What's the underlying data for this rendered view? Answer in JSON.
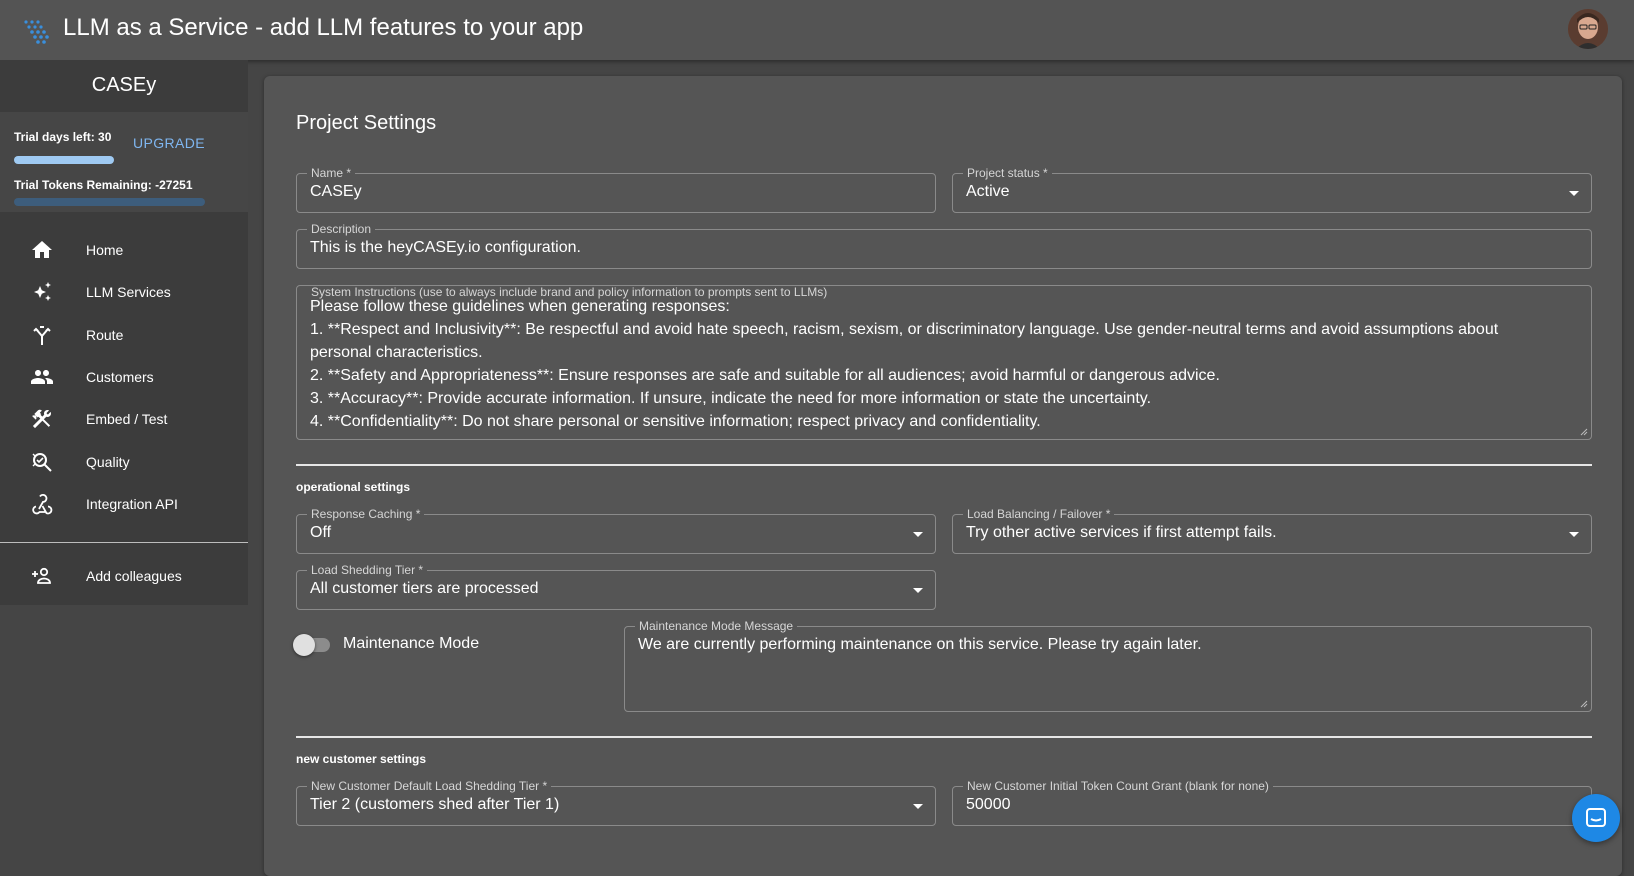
{
  "appbar": {
    "title": "LLM as a Service - add LLM features to your app"
  },
  "sidebar": {
    "project_name": "CASEy",
    "trial_days": "Trial days left: 30",
    "upgrade": "UPGRADE",
    "trial_tokens": "Trial Tokens Remaining: -27251",
    "items": [
      {
        "label": "Home",
        "icon": "home-icon"
      },
      {
        "label": "LLM Services",
        "icon": "sparkles-icon"
      },
      {
        "label": "Route",
        "icon": "route-icon"
      },
      {
        "label": "Customers",
        "icon": "people-icon"
      },
      {
        "label": "Embed / Test",
        "icon": "tools-icon"
      },
      {
        "label": "Quality",
        "icon": "quality-search-icon"
      },
      {
        "label": "Integration API",
        "icon": "webhook-icon"
      }
    ],
    "add_colleagues": {
      "label": "Add colleagues",
      "icon": "person-add-icon"
    }
  },
  "main": {
    "title": "Project Settings",
    "name": {
      "label": "Name *",
      "value": "CASEy"
    },
    "status": {
      "label": "Project status *",
      "value": "Active"
    },
    "description": {
      "label": "Description",
      "value": "This is the heyCASEy.io configuration."
    },
    "instructions": {
      "label": "System Instructions (use to always include brand and policy information to prompts sent to LLMs)",
      "value": "Please follow these guidelines when generating responses:\n1. **Respect and Inclusivity**: Be respectful and avoid hate speech, racism, sexism, or discriminatory language. Use gender-neutral terms and avoid assumptions about personal characteristics.\n2. **Safety and Appropriateness**: Ensure responses are safe and suitable for all audiences; avoid harmful or dangerous advice.\n3. **Accuracy**: Provide accurate information. If unsure, indicate the need for more information or state the uncertainty.\n4. **Confidentiality**: Do not share personal or sensitive information; respect privacy and confidentiality."
    },
    "operational": {
      "title": "operational settings",
      "caching": {
        "label": "Response Caching *",
        "value": "Off"
      },
      "balancing": {
        "label": "Load Balancing / Failover *",
        "value": "Try other active services if first attempt fails."
      },
      "shedding": {
        "label": "Load Shedding Tier  *",
        "value": "All customer tiers are processed"
      },
      "maintenance_toggle": {
        "label": "Maintenance Mode",
        "on": false
      },
      "maintenance_message": {
        "label": "Maintenance Mode Message",
        "value": "We are currently performing maintenance on this service. Please try again later."
      }
    },
    "new_customer": {
      "title": "new customer settings",
      "default_tier": {
        "label": "New Customer Default Load Shedding Tier  *",
        "value": "Tier 2 (customers shed after Tier 1)"
      },
      "token_grant": {
        "label": "New Customer Initial Token Count Grant (blank for none)",
        "value": "50000"
      }
    }
  },
  "colors": {
    "accent": "#7fb6f0",
    "fab": "#1e88e5",
    "surface": "#555555",
    "appbar": "#545454"
  }
}
